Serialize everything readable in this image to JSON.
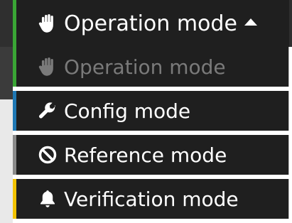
{
  "header": {
    "label": "Operation mode",
    "icon": "hand-icon",
    "accent_color": "#3aa635"
  },
  "menu": {
    "items": [
      {
        "label": "Operation mode",
        "icon": "hand-icon",
        "color": "#3aa635",
        "state": "disabled"
      },
      {
        "label": "Config mode",
        "icon": "wrench-icon",
        "color": "#1f78b4",
        "state": "enabled"
      },
      {
        "label": "Reference mode",
        "icon": "prohibit-icon",
        "color": "#8a8a8a",
        "state": "enabled"
      },
      {
        "label": "Verification mode",
        "icon": "bell-icon",
        "color": "#f2c200",
        "state": "enabled"
      }
    ]
  }
}
